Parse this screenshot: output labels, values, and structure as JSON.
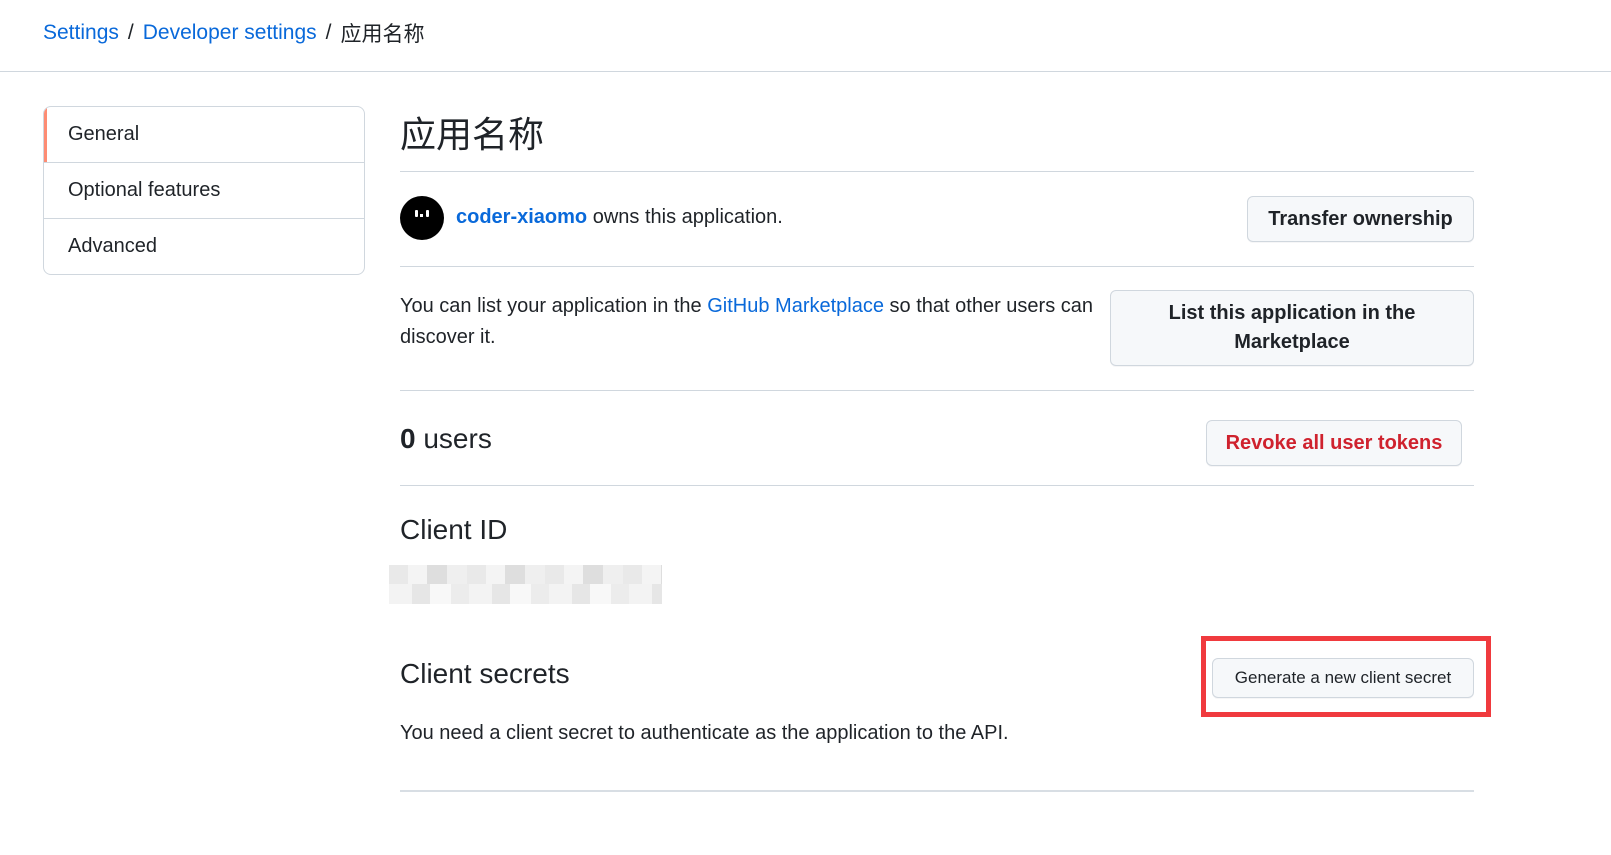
{
  "breadcrumb": {
    "settings": "Settings",
    "separator": "/",
    "developer_settings": "Developer settings",
    "current": "应用名称"
  },
  "sidebar": {
    "items": [
      {
        "label": "General",
        "active": true
      },
      {
        "label": "Optional features",
        "active": false
      },
      {
        "label": "Advanced",
        "active": false
      }
    ]
  },
  "main": {
    "title": "应用名称",
    "owner": {
      "username": "coder-xiaomo",
      "suffix": " owns this application.",
      "transfer_button": "Transfer ownership"
    },
    "marketplace": {
      "text_before": "You can list your application in the ",
      "link": "GitHub Marketplace",
      "text_after": " so that other users can discover it.",
      "button": "List this application in the Marketplace"
    },
    "users": {
      "count": "0",
      "label": " users",
      "revoke_button": "Revoke all user tokens"
    },
    "client_id": {
      "heading": "Client ID"
    },
    "client_secrets": {
      "heading": "Client secrets",
      "generate_button": "Generate a new client secret",
      "description": "You need a client secret to authenticate as the application to the API."
    }
  },
  "colors": {
    "link": "#0969da",
    "danger": "#cf222e",
    "active_indicator": "#fd8c73",
    "highlight_box": "#f03a3e",
    "border": "#d0d7de"
  }
}
